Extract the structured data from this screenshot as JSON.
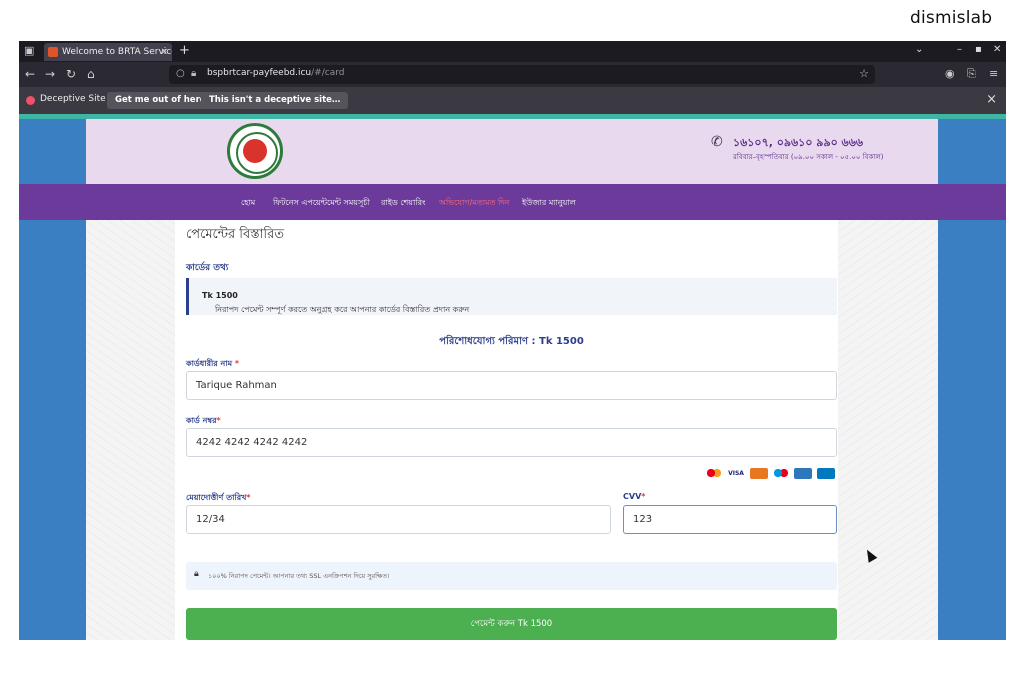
{
  "watermark": "dismislab",
  "browser": {
    "tab_title": "Welcome to BRTA Service",
    "tab_close": "×",
    "new_tab": "+",
    "url_host": "bspbrtcar-payfeebd.icu",
    "url_path": "/#/card",
    "warning": {
      "text": "Deceptive Site!",
      "get_out": "Get me out of here!",
      "not_deceptive": "This isn't a deceptive site…",
      "close": "×"
    }
  },
  "header": {
    "hotline_number": "১৬১০৭, ০৯৬১০ ৯৯০ ৬৬৬",
    "hotline_hours": "রবিবার–বৃহস্পতিবার (০৯.০০ সকাল - ০৫.০০ বিকাল)"
  },
  "menu": {
    "items": [
      {
        "label": "হোম",
        "active": false
      },
      {
        "label": "ফিটনেস এপয়েন্টমেন্ট সময়সূচী",
        "active": false
      },
      {
        "label": "রাইড শেয়ারিং",
        "active": false
      },
      {
        "label": "অভিযোগ/মতামত দিন",
        "active": true
      },
      {
        "label": "ইউজার ম্যানুয়াল",
        "active": false
      }
    ]
  },
  "form": {
    "page_title": "পেমেন্টের বিস্তারিত",
    "section_title": "কার্ডের তথ্য",
    "alert_text": "নিরাপদ পেমেন্ট সম্পূর্ণ করতে অনুগ্রহ করে আপনার কার্ডের বিস্তারিত প্রদান করুন",
    "alert_amount": "Tk 1500",
    "amount_label": "পরিশোধযোগ্য পরিমাণ : Tk 1500",
    "cardholder_label": "কার্ডধারীর নাম",
    "cardholder_value": "Tarique Rahman",
    "card_number_label": "কার্ড নম্বর",
    "card_number_value": "4242 4242 4242 4242",
    "expiry_label": "মেয়াদোত্তীর্ণ তারিখ",
    "expiry_value": "12/34",
    "cvv_label": "CVV",
    "cvv_value": "123",
    "required_mark": "*",
    "card_brands": [
      "mastercard",
      "VISA",
      "discover",
      "maestro",
      "amex",
      "diners"
    ],
    "secure_text": "১০০% নিরাপদ পেমেন্ট। আপনার তথ্য SSL এনক্রিপশন দিয়ে সুরক্ষিত।",
    "pay_button": "পেমেন্ট করুন Tk 1500"
  },
  "colors": {
    "menu_bg": "#6b3a9b",
    "active_menu": "#ff6b7a",
    "pay_button": "#4caf50",
    "label_blue": "#2d3e8c"
  }
}
